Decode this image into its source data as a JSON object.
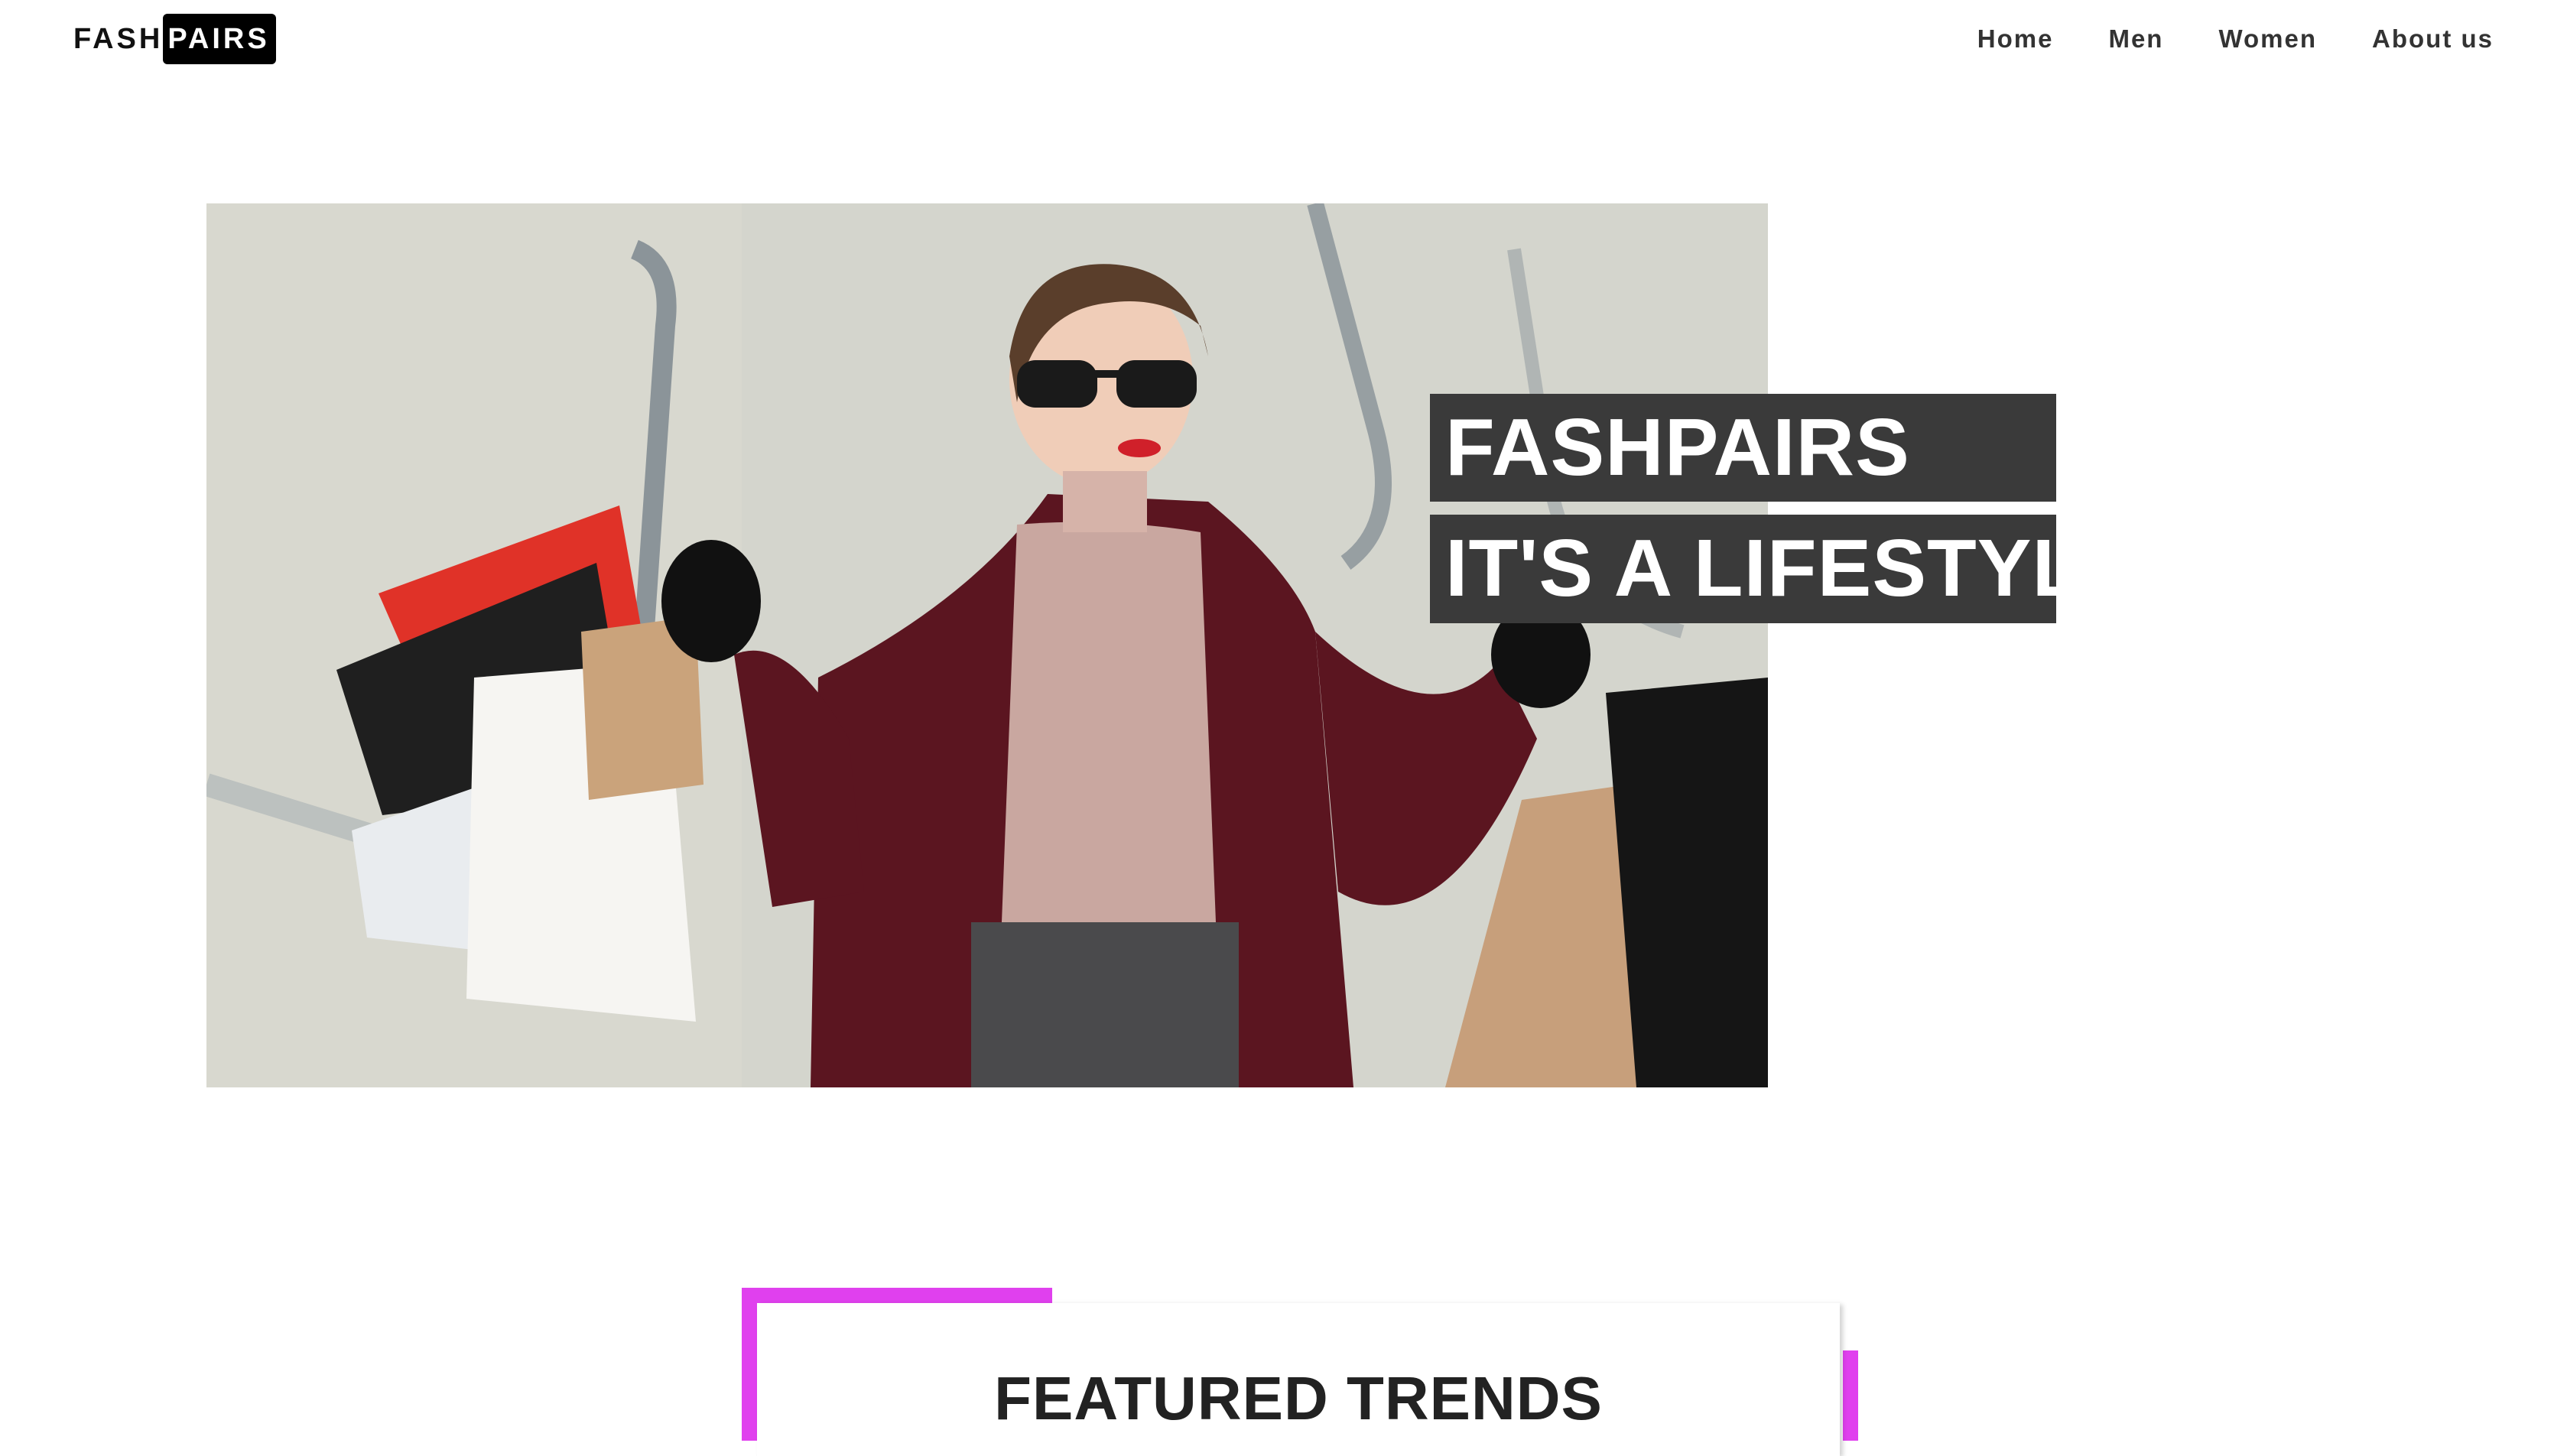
{
  "brand": {
    "logo_part1": "FASH",
    "logo_part2": "PAIRS"
  },
  "nav": {
    "items": [
      "Home",
      "Men",
      "Women",
      "About us"
    ]
  },
  "hero": {
    "line1": "FASHPAIRS",
    "line2": "IT'S A LIFESTYLE",
    "image_alt": "woman-with-shopping-bags-photo"
  },
  "featured": {
    "title": "FEATURED TRENDS"
  },
  "colors": {
    "accent_pink": "#e040ee",
    "hero_label_bg": "#3a3a3a",
    "text_dark": "#222222"
  }
}
